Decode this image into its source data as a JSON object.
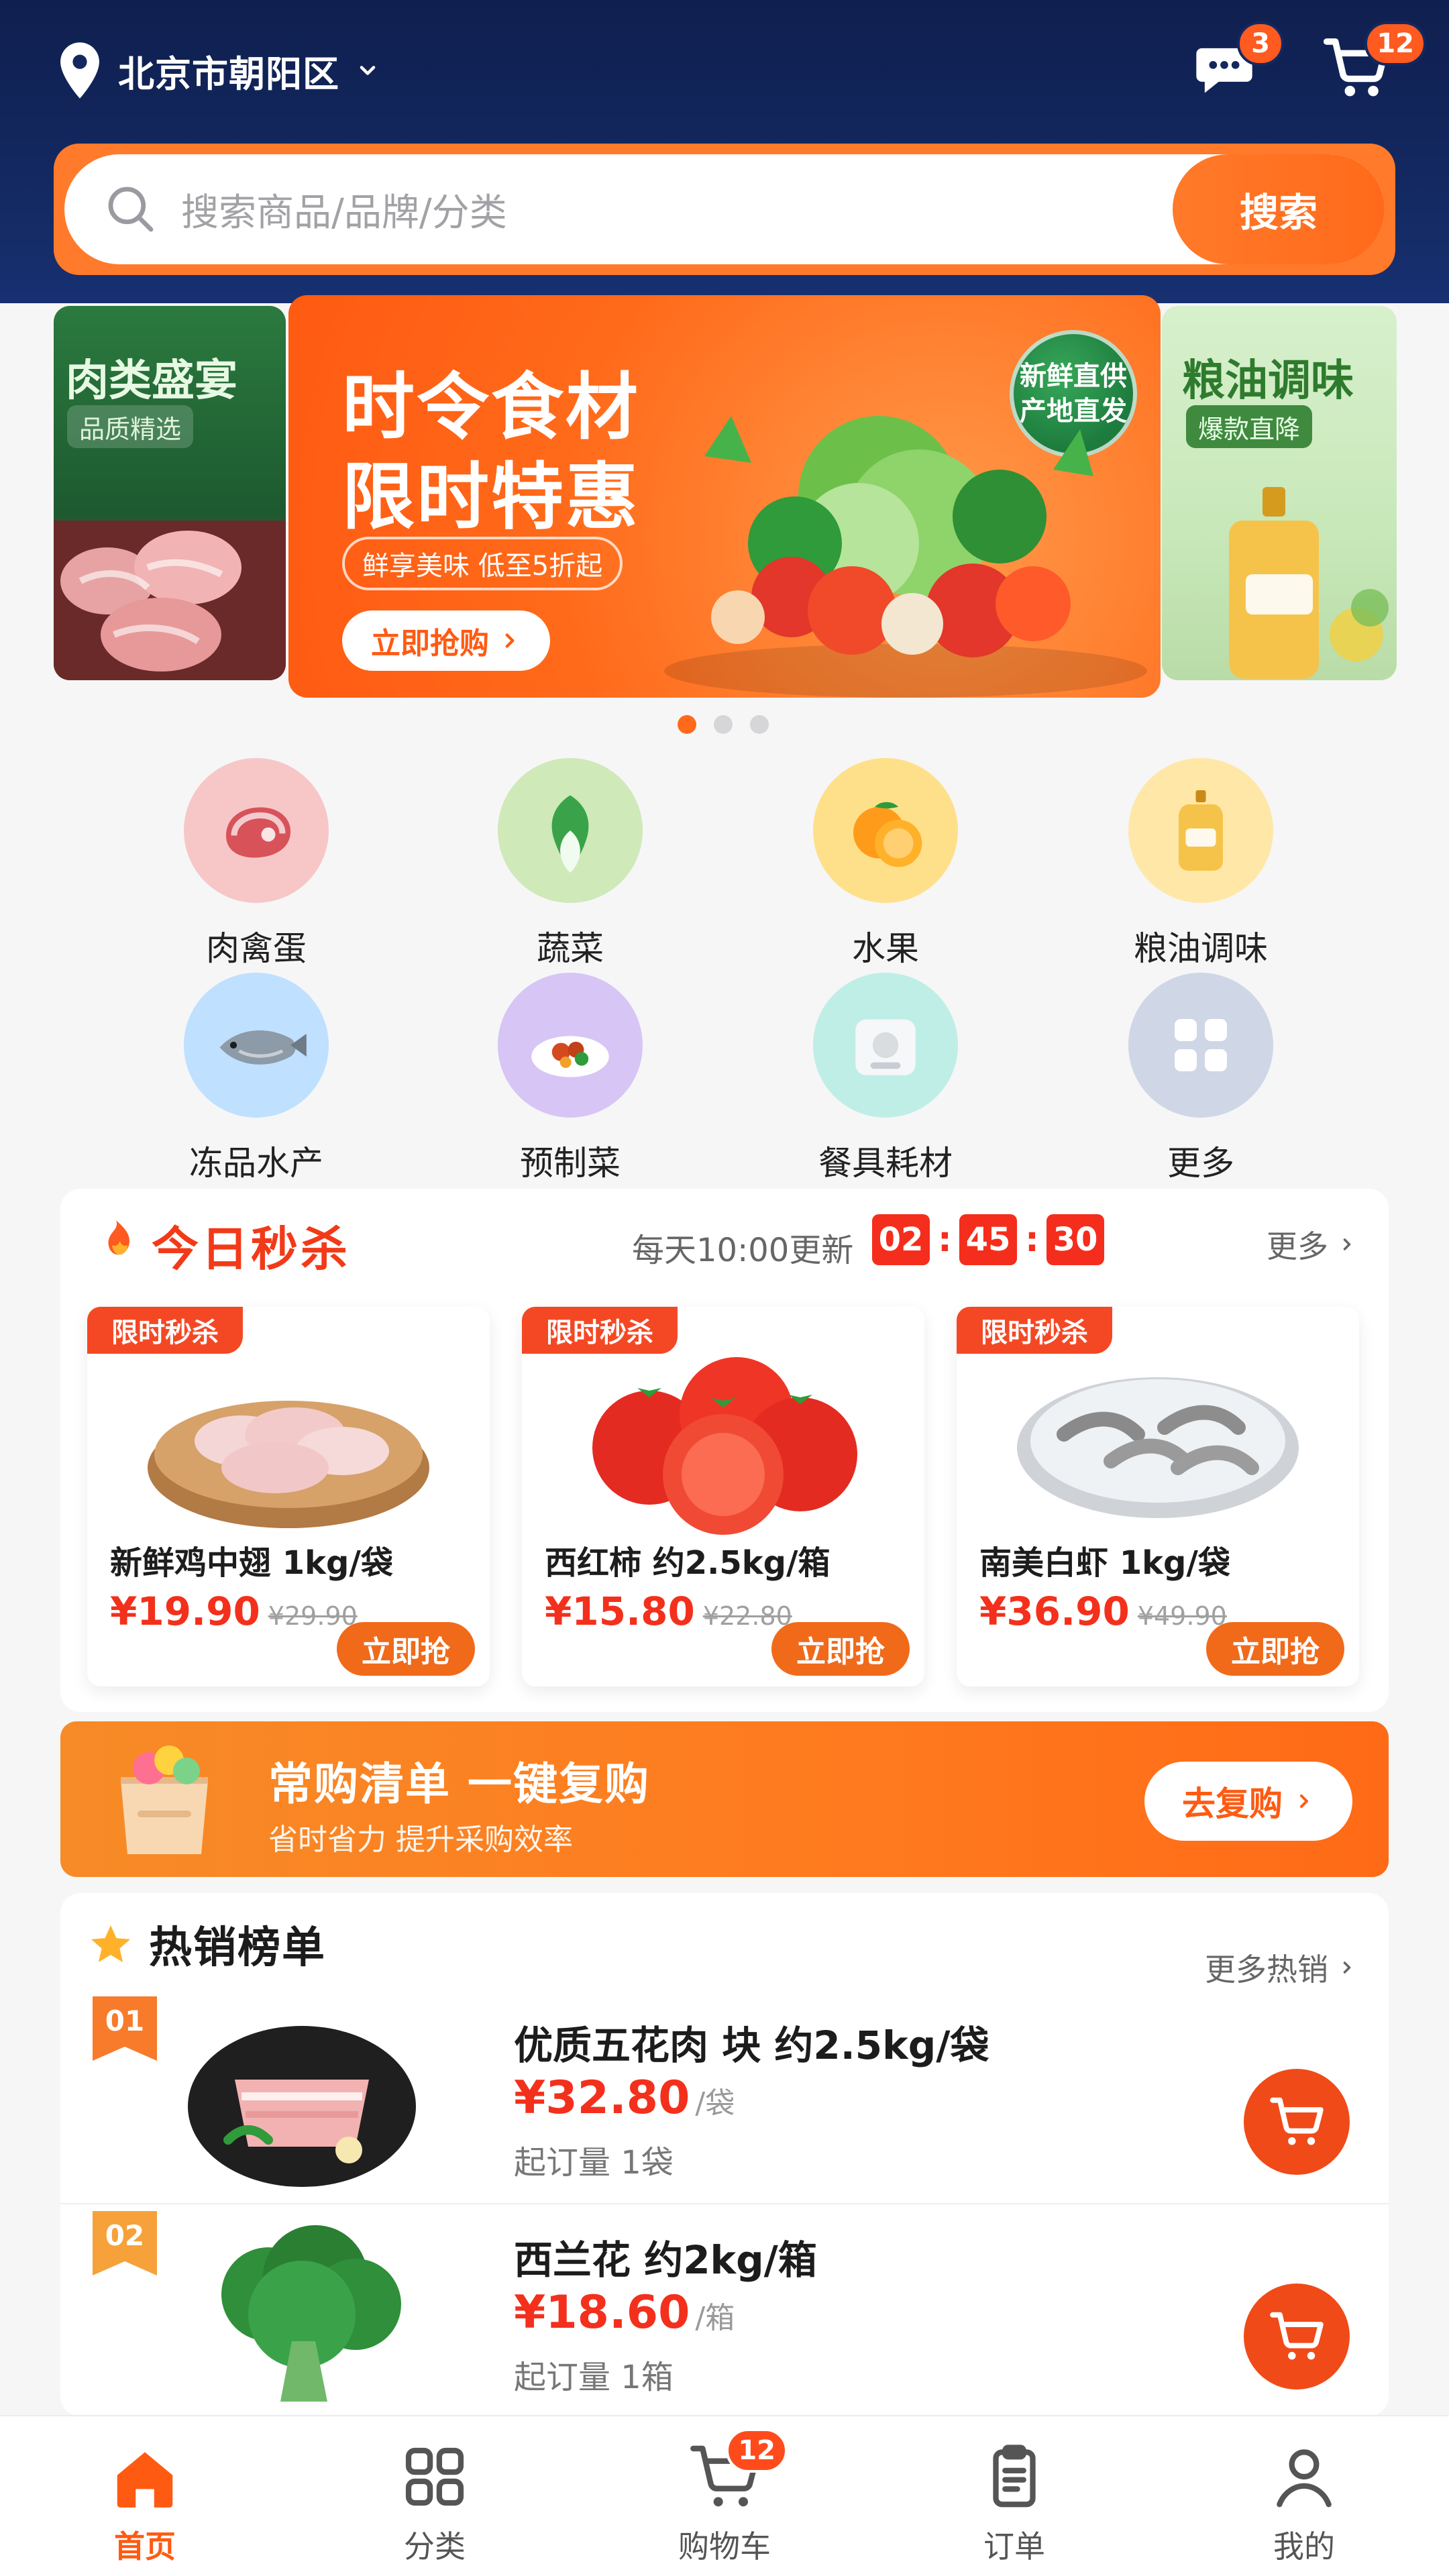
{
  "header": {
    "location": "北京市朝阳区",
    "message_badge": "3",
    "cart_badge": "12",
    "search_placeholder": "搜索商品/品牌/分类",
    "search_button": "搜索"
  },
  "carousel": {
    "left_title": "肉类盛宴",
    "left_tag": "品质精选",
    "main_title_line1": "时令食材",
    "main_title_line2": "限时特惠",
    "main_sub": "鲜享美味 低至5折起",
    "main_cta": "立即抢购",
    "main_badge": "新鲜直供 产地直发",
    "right_title": "粮油调味",
    "right_tag": "爆款直降",
    "active_index": 0,
    "count": 3
  },
  "categories": [
    {
      "label": "肉禽蛋",
      "icon": "meat-steak-icon",
      "bg": "#f7c7c7"
    },
    {
      "label": "蔬菜",
      "icon": "bok-choy-icon",
      "bg": "#cfe9b9"
    },
    {
      "label": "水果",
      "icon": "orange-fruit-icon",
      "bg": "#ffe08a"
    },
    {
      "label": "粮油调味",
      "icon": "oil-bottle-icon",
      "bg": "#ffe7a8"
    },
    {
      "label": "冻品水产",
      "icon": "fish-icon",
      "bg": "#bfe0ff"
    },
    {
      "label": "预制菜",
      "icon": "prepared-dish-icon",
      "bg": "#d7c5f5"
    },
    {
      "label": "餐具耗材",
      "icon": "tableware-icon",
      "bg": "#bfeee6"
    },
    {
      "label": "更多",
      "icon": "grid-more-icon",
      "bg": "#cfd6e6"
    }
  ],
  "flash_sale": {
    "title": "今日秒杀",
    "update_note": "每天10:00更新",
    "timer": {
      "hh": "02",
      "mm": "45",
      "ss": "30"
    },
    "more": "更多",
    "items": [
      {
        "tag": "限时秒杀",
        "name": "新鲜鸡中翅 1kg/袋",
        "price": "¥19.90",
        "orig": "¥29.90",
        "btn": "立即抢"
      },
      {
        "tag": "限时秒杀",
        "name": "西红柿 约2.5kg/箱",
        "price": "¥15.80",
        "orig": "¥22.80",
        "btn": "立即抢"
      },
      {
        "tag": "限时秒杀",
        "name": "南美白虾 1kg/袋",
        "price": "¥36.90",
        "orig": "¥49.90",
        "btn": "立即抢"
      }
    ]
  },
  "reorder": {
    "title": "常购清单 一键复购",
    "subtitle": "省时省力 提升采购效率",
    "button": "去复购"
  },
  "hot_list": {
    "title": "热销榜单",
    "more": "更多热销",
    "items": [
      {
        "rank": "01",
        "name": "优质五花肉 块 约2.5kg/袋",
        "price": "¥32.80",
        "unit": "/袋",
        "moq": "起订量 1袋"
      },
      {
        "rank": "02",
        "name": "西兰花 约2kg/箱",
        "price": "¥18.60",
        "unit": "/箱",
        "moq": "起订量 1箱"
      }
    ]
  },
  "tabbar": {
    "tabs": [
      {
        "label": "首页",
        "icon": "home-icon"
      },
      {
        "label": "分类",
        "icon": "category-grid-icon"
      },
      {
        "label": "购物车",
        "icon": "cart-icon"
      },
      {
        "label": "订单",
        "icon": "order-clipboard-icon"
      },
      {
        "label": "我的",
        "icon": "user-profile-icon"
      }
    ],
    "active_index": 0,
    "cart_badge": "12"
  },
  "colors": {
    "brand_orange": "#ff6a1a",
    "header_navy": "#13285f",
    "price_red": "#f3301c"
  }
}
